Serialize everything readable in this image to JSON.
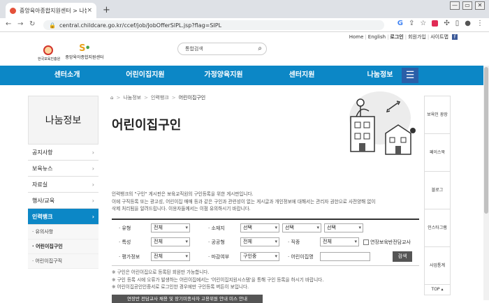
{
  "browser": {
    "tab_title": "중앙육아종합지원센터 > 나눔정보",
    "tab_close": "×",
    "new_tab": "+",
    "url": "central.childcare.go.kr/ccef/job/JobOfferSlPL.jsp?flag=SIPL",
    "win_controls": [
      "—",
      "▭",
      "✕"
    ]
  },
  "header": {
    "util_links": [
      "Home",
      "English",
      "로그인",
      "회원가입",
      "사이트맵"
    ],
    "util_bold": "로그인",
    "facebook": "f",
    "logo1_text": "한국보육진흥원",
    "logo2_mark": "중앙",
    "logo2_text": "중앙육아종합지원센터",
    "search_placeholder": "통합검색"
  },
  "gnb": {
    "items": [
      "센터소개",
      "어린이집지원",
      "가정양육지원",
      "센터지원",
      "나눔정보"
    ],
    "menu_icon": "☰"
  },
  "lnb": {
    "title": "나눔정보",
    "items": [
      {
        "label": "공지사항",
        "active": false
      },
      {
        "label": "보육뉴스",
        "active": false
      },
      {
        "label": "자료실",
        "active": false
      },
      {
        "label": "행사/교육",
        "active": false
      },
      {
        "label": "인력뱅크",
        "active": true
      }
    ],
    "subitems": [
      "유의사항",
      "어린이집구인",
      "어린이집구직"
    ]
  },
  "breadcrumb": [
    "⌂",
    "나눔정보",
    "인력뱅크",
    "어린이집구인"
  ],
  "page_title": "어린이집구인",
  "description": [
    "인력뱅크의 \"구인\" 게시판은 보육교직원의 구인등록을 위한 게시판입니다.",
    "이에 구직등록 또는 광고성, 어린이집 매매 등과 같은 구인과 관련성이 없는 게시글과 개인정보에 대해서는 관리자 권한으로 사전양해 없이",
    "삭제 처리됨을 알려드립니다. 이용자들께서는 이점 유의하시기 바랍니다."
  ],
  "search_form": {
    "type_label": "· 유형",
    "type_value": "전체",
    "location_label": "· 소재지",
    "location_values": [
      "선택",
      "선택",
      "선택"
    ],
    "feature_label": "· 특성",
    "feature_value": "전체",
    "public_label": "· 공공형",
    "public_value": "전체",
    "job_label": "· 직종",
    "job_value": "전체",
    "linked_label": "연장보육반전담교사",
    "eval_label": "· 평가정보",
    "eval_value": "전체",
    "deadline_label": "· 마감여부",
    "deadline_value": "구인중",
    "name_label": "· 어린이집명",
    "name_value": "",
    "search_button": "검색"
  },
  "notes": [
    "※ 구인은 어린이집으로 등록된 회원만 가능합니다.",
    "※ 구인 등록 시에 오류가 발생하는 어린이집에서는 '어린이집지원시스템'을 통해 구인 등록을 하시기 바랍니다.",
    "※ 어린이집공인인증서로 로그인한 경우에만 구인등록 버튼이 보입니다."
  ],
  "bottom_button": "연장반 전담교사 채용 및 장기미종사자 고용위원 안내 미스 안내",
  "quick_menu": {
    "items": [
      "보육인 광장",
      "페이스북",
      "블로그",
      "인스타그램",
      "사업통계"
    ],
    "top_label": "TOP ▴"
  },
  "colors": {
    "gnb_blue": "#0c87c6",
    "menu_navy": "#2a5fa8",
    "lnb_active": "#0c87c6",
    "button_gray": "#555555"
  }
}
